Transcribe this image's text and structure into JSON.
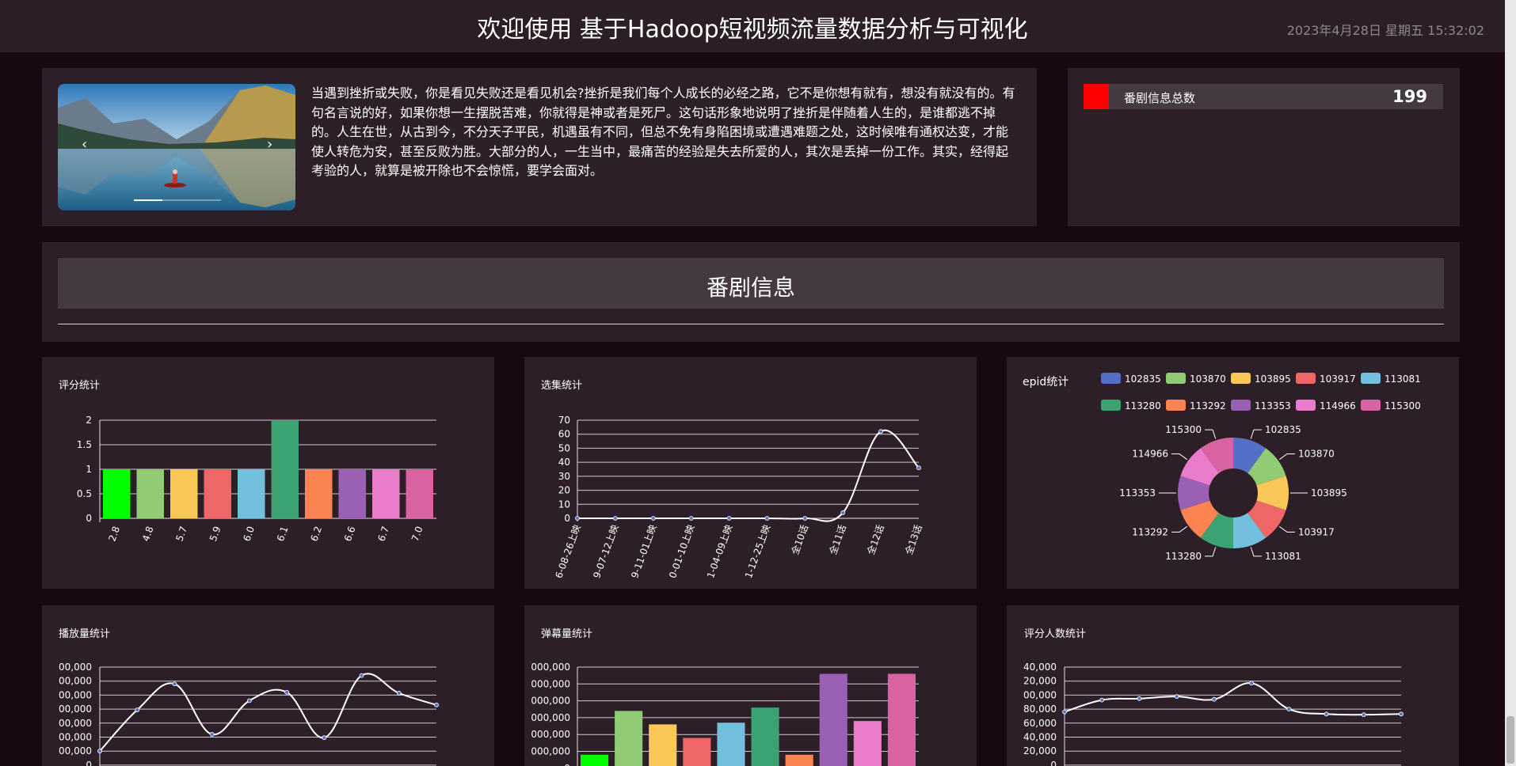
{
  "header": {
    "title": "欢迎使用 基于Hadoop短视频流量数据分析与可视化",
    "datetime": "2023年4月28日 星期五 15:32:02"
  },
  "carousel": {
    "prev_icon": "‹",
    "next_icon": "›",
    "image": "mountain-lake-kayak-photo",
    "active_slide": 1,
    "slide_count": 3
  },
  "intro": {
    "text": "当遇到挫折或失败，你是看见失败还是看见机会?挫折是我们每个人成长的必经之路，它不是你想有就有，想没有就没有的。有句名言说的好，如果你想一生摆脱苦难，你就得是神或者是死尸。这句话形象地说明了挫折是伴随着人生的，是谁都逃不掉的。人生在世，从古到今，不分天子平民，机遇虽有不同，但总不免有身陷困境或遭遇难题之处，这时候唯有通权达变，才能使人转危为安，甚至反败为胜。大部分的人，一生当中，最痛苦的经验是失去所爱的人，其次是丢掉一份工作。其实，经得起考验的人，就算是被开除也不会惊慌，要学会面对。"
  },
  "stat": {
    "label": "番剧信息总数",
    "value": "199",
    "color": "#ff0000"
  },
  "section": {
    "title": "番剧信息"
  },
  "colors": {
    "palette": [
      "#5470c6",
      "#91cc75",
      "#fac858",
      "#ee6666",
      "#73c0de",
      "#3ba272",
      "#fc8452",
      "#9a60b4",
      "#ea7ccc",
      "#d962a3"
    ],
    "first_bar": "#00ff00",
    "panel": "#2d1f28",
    "background": "#180811"
  },
  "chart_data": [
    {
      "id": "rating",
      "type": "bar",
      "title": "评分统计",
      "categories": [
        "2.8",
        "4.8",
        "5.7",
        "5.9",
        "6.0",
        "6.1",
        "6.2",
        "6.6",
        "6.7",
        "7.0"
      ],
      "values": [
        1,
        1,
        1,
        1,
        1,
        2,
        1,
        1,
        1,
        1
      ],
      "ylim": [
        0,
        2
      ],
      "yticks": [
        "0",
        "0.5",
        "1",
        "1.5",
        "2"
      ],
      "grid": true
    },
    {
      "id": "episodes",
      "type": "line",
      "title": "选集统计",
      "categories": [
        "6-08-26上映",
        "9-07-12上映",
        "9-11-01上映",
        "0-01-10上映",
        "1-04-09上映",
        "1-12-25上映",
        "全10话",
        "全11话",
        "全12话",
        "全13话"
      ],
      "values": [
        0,
        0,
        0,
        0,
        0,
        0,
        0,
        4,
        62,
        36
      ],
      "ylim": [
        0,
        70
      ],
      "yticks": [
        "0",
        "10",
        "20",
        "30",
        "40",
        "50",
        "60",
        "70"
      ],
      "grid": true
    },
    {
      "id": "epid",
      "type": "pie",
      "title": "epid统计",
      "labels": [
        "102835",
        "103870",
        "103895",
        "103917",
        "113081",
        "113280",
        "113292",
        "113353",
        "114966",
        "115300"
      ],
      "values": [
        1,
        1,
        1,
        1,
        1,
        1,
        1,
        1,
        1,
        1
      ],
      "legend_position": "top"
    },
    {
      "id": "plays",
      "type": "line",
      "title": "播放量统计",
      "values": [
        0,
        245000,
        400000,
        100000,
        300000,
        350000,
        80000,
        450000,
        345000,
        275000
      ],
      "yticks": [
        "00,000",
        "00,000",
        "00,000",
        "00,000",
        "00,000",
        "00,000",
        "00,000",
        "0"
      ],
      "grid": true
    },
    {
      "id": "danmaku",
      "type": "bar",
      "title": "弹幕量统计",
      "values": [
        80000,
        340000,
        260000,
        180000,
        270000,
        360000,
        80000,
        560000,
        280000,
        560000
      ],
      "yticks": [
        "000,000",
        "000,000",
        "000,000",
        "000,000",
        "000,000",
        "000,000",
        "0"
      ],
      "grid": true
    },
    {
      "id": "raters",
      "type": "line",
      "title": "评分人数统计",
      "values": [
        76000,
        93000,
        95000,
        98000,
        94000,
        117000,
        80000,
        73000,
        72000,
        73000
      ],
      "yticks": [
        "40,000",
        "20,000",
        "00,000",
        "80,000",
        "60,000",
        "40,000",
        "20,000",
        "0"
      ],
      "grid": true
    }
  ]
}
